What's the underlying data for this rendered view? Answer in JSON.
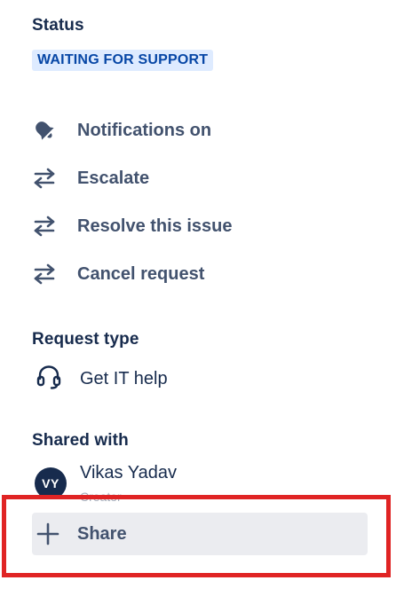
{
  "status": {
    "title": "Status",
    "badge": "WAITING FOR SUPPORT"
  },
  "actions": [
    {
      "label": "Notifications on",
      "icon": "bell-icon"
    },
    {
      "label": "Escalate",
      "icon": "transition-arrows-icon"
    },
    {
      "label": "Resolve this issue",
      "icon": "transition-arrows-icon"
    },
    {
      "label": "Cancel request",
      "icon": "transition-arrows-icon"
    }
  ],
  "request_type": {
    "title": "Request type",
    "value": "Get IT help",
    "icon": "headset-icon"
  },
  "shared_with": {
    "title": "Shared with",
    "users": [
      {
        "initials": "VY",
        "name": "Vikas Yadav",
        "role": "Creator"
      }
    ],
    "share_label": "Share"
  },
  "colors": {
    "text_primary": "#172b4d",
    "text_secondary": "#42526e",
    "badge_bg": "#deebff",
    "badge_text": "#0747a6",
    "share_bg": "#ebecf0",
    "highlight": "#e02424"
  }
}
